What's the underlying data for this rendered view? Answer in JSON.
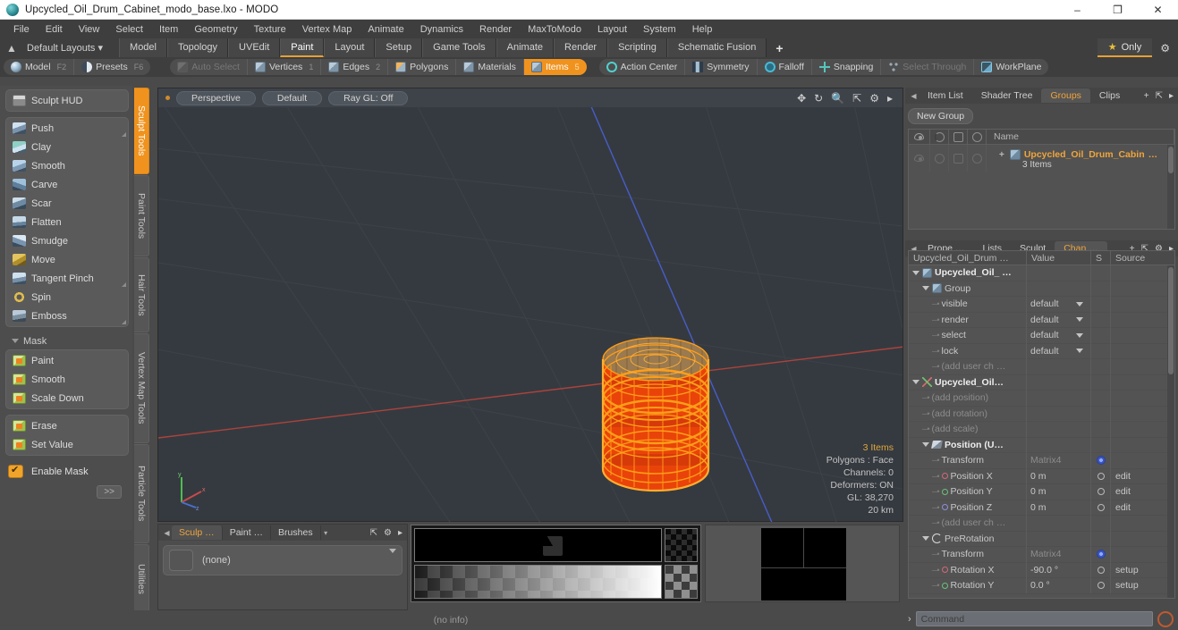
{
  "window": {
    "title": "Upcycled_Oil_Drum_Cabinet_modo_base.lxo - MODO",
    "app_icon": "modo-sphere-icon",
    "minimize": "–",
    "maximize": "❐",
    "close": "✕"
  },
  "menubar": {
    "items": [
      "File",
      "Edit",
      "View",
      "Select",
      "Item",
      "Geometry",
      "Texture",
      "Vertex Map",
      "Animate",
      "Dynamics",
      "Render",
      "MaxToModo",
      "Layout",
      "System",
      "Help"
    ]
  },
  "layoutbar": {
    "home_icon": "home-icon",
    "default_layouts": "Default Layouts",
    "tabs": [
      {
        "label": "Model",
        "active": false
      },
      {
        "label": "Topology",
        "active": false
      },
      {
        "label": "UVEdit",
        "active": false
      },
      {
        "label": "Paint",
        "active": true
      },
      {
        "label": "Layout",
        "active": false
      },
      {
        "label": "Setup",
        "active": false
      },
      {
        "label": "Game Tools",
        "active": false
      },
      {
        "label": "Animate",
        "active": false
      },
      {
        "label": "Render",
        "active": false
      },
      {
        "label": "Scripting",
        "active": false
      },
      {
        "label": "Schematic Fusion",
        "active": false
      }
    ],
    "add": "+",
    "only": "Only",
    "star_icon": "star-icon",
    "gear_icon": "gear-icon"
  },
  "modebar": {
    "left": [
      {
        "label": "Model",
        "shortcut": "F2",
        "icon": "sphere-icon",
        "state": "normal"
      },
      {
        "label": "Presets",
        "shortcut": "F6",
        "icon": "sphere-half-icon",
        "state": "normal"
      }
    ],
    "selection": [
      {
        "label": "Auto Select",
        "shortcut": "",
        "icon": "cube-dim-icon",
        "state": "dim"
      },
      {
        "label": "Vertices",
        "shortcut": "1",
        "icon": "cube-icon",
        "state": "normal"
      },
      {
        "label": "Edges",
        "shortcut": "2",
        "icon": "cube-icon",
        "state": "normal"
      },
      {
        "label": "Polygons",
        "shortcut": "",
        "icon": "cube-orange-icon",
        "state": "normal"
      },
      {
        "label": "Materials",
        "shortcut": "",
        "icon": "cube-icon",
        "state": "normal"
      },
      {
        "label": "Items",
        "shortcut": "5",
        "icon": "cube-icon",
        "state": "active"
      }
    ],
    "tools": [
      {
        "label": "Action Center",
        "icon": "crosshair-icon",
        "state": "normal"
      },
      {
        "label": "Symmetry",
        "icon": "symmetry-icon",
        "state": "normal"
      },
      {
        "label": "Falloff",
        "icon": "falloff-icon",
        "state": "normal"
      },
      {
        "label": "Snapping",
        "icon": "snapping-icon",
        "state": "normal"
      },
      {
        "label": "Select Through",
        "icon": "select-through-icon",
        "state": "dim"
      },
      {
        "label": "WorkPlane",
        "icon": "workplane-icon",
        "state": "normal"
      }
    ]
  },
  "sculpt_panel": {
    "hud_button": "Sculpt HUD",
    "hud_icon": "hud-icon",
    "tools": [
      {
        "label": "Push",
        "icon": "push-brush-icon",
        "corner": true
      },
      {
        "label": "Clay",
        "icon": "clay-brush-icon",
        "corner": false
      },
      {
        "label": "Smooth",
        "icon": "smooth-brush-icon",
        "corner": false
      },
      {
        "label": "Carve",
        "icon": "carve-brush-icon",
        "corner": false
      },
      {
        "label": "Scar",
        "icon": "scar-brush-icon",
        "corner": false
      },
      {
        "label": "Flatten",
        "icon": "flatten-brush-icon",
        "corner": false
      },
      {
        "label": "Smudge",
        "icon": "smudge-brush-icon",
        "corner": false
      },
      {
        "label": "Move",
        "icon": "move-brush-icon",
        "corner": false
      },
      {
        "label": "Tangent Pinch",
        "icon": "tangent-pinch-icon",
        "corner": true
      },
      {
        "label": "Spin",
        "icon": "spin-brush-icon",
        "corner": false
      },
      {
        "label": "Emboss",
        "icon": "emboss-brush-icon",
        "corner": true
      }
    ],
    "mask_header": "Mask",
    "mask_tools": [
      {
        "label": "Paint",
        "icon": "mask-paint-icon"
      },
      {
        "label": "Smooth",
        "icon": "mask-smooth-icon"
      },
      {
        "label": "Scale Down",
        "icon": "mask-scale-down-icon"
      }
    ],
    "mask_tools2": [
      {
        "label": "Erase",
        "icon": "mask-erase-icon"
      },
      {
        "label": "Set Value",
        "icon": "mask-set-value-icon"
      }
    ],
    "enable_mask": "Enable Mask",
    "enable_mask_checked": true,
    "more_button": ">>"
  },
  "vertical_tabs": [
    {
      "label": "Sculpt Tools",
      "active": true
    },
    {
      "label": "Paint Tools",
      "active": false
    },
    {
      "label": "Hair Tools",
      "active": false
    },
    {
      "label": "Vertex Map Tools",
      "active": false
    },
    {
      "label": "Particle Tools",
      "active": false
    },
    {
      "label": "Utilities",
      "active": false
    }
  ],
  "viewport": {
    "dot_icon": "viewport-indicator-dot",
    "buttons": [
      "Perspective",
      "Default",
      "Ray GL: Off"
    ],
    "header_icons": [
      "pan-icon",
      "rotate-icon",
      "zoom-icon",
      "fit-icon",
      "gear-icon",
      "chevron-right-icon"
    ],
    "stats": [
      "3 Items",
      "Polygons : Face",
      "Channels: 0",
      "Deformers: ON",
      "GL: 38,270",
      "20 km"
    ],
    "model": "oil-drum-wireframe",
    "axis_labels": [
      "y",
      "x",
      "z"
    ],
    "background_color": "#353a40",
    "wire_color": "#ff9e18",
    "model_body_color": "#e33a0e"
  },
  "bottom_panel": {
    "tabs": [
      {
        "label": "Sculp …",
        "active": true
      },
      {
        "label": "Paint …",
        "active": false
      },
      {
        "label": "Brushes",
        "active": false
      }
    ],
    "dropdown_icon": "chevron-down-icon",
    "tab_icons": [
      "expand-icon",
      "gear-icon",
      "chevron-right-icon"
    ],
    "brush_value": "(none)",
    "brush_swatch": "brush-preview-swatch"
  },
  "right_panel": {
    "top_tabs": [
      {
        "label": "Item List",
        "active": false
      },
      {
        "label": "Shader Tree",
        "active": false
      },
      {
        "label": "Groups",
        "active": true
      },
      {
        "label": "Clips",
        "active": false
      }
    ],
    "top_tab_icons": [
      "plus-icon",
      "expand-icon",
      "chevron-right-icon"
    ],
    "new_group_button": "New Group",
    "tree_columns": [
      "eye-icon",
      "render-icon",
      "lock-icon",
      "select-icon",
      "Name"
    ],
    "tree_rows": [
      {
        "name": "Upcycled_Oil_Drum_Cabin",
        "ellipsis": "…",
        "sub": "3 Items",
        "icon": "group-item-icon"
      }
    ],
    "mid_tabs": [
      {
        "label": "Prope …",
        "active": false
      },
      {
        "label": "Lists",
        "active": false
      },
      {
        "label": "Sculpt",
        "active": false
      },
      {
        "label": "Chan …",
        "active": true
      }
    ],
    "mid_tab_icons": [
      "plus-icon",
      "expand-icon",
      "gear-icon",
      "chevron-right-icon"
    ],
    "chan_columns": [
      "Upcycled_Oil_Drum …",
      "Value",
      "S",
      "Source"
    ],
    "chan_rows": [
      {
        "indent": 0,
        "twisty": "down",
        "icon": "item-icon",
        "label": "Upcycled_Oil_ …",
        "value": "",
        "bold": true,
        "dim": false,
        "s": "",
        "source": ""
      },
      {
        "indent": 1,
        "twisty": "down",
        "icon": "item-icon",
        "label": "Group",
        "value": "",
        "bold": false,
        "dim": false,
        "s": "",
        "source": ""
      },
      {
        "indent": 2,
        "twisty": "leaf",
        "icon": "",
        "label": "visible",
        "value": "default",
        "dropdown": true,
        "bold": false,
        "dim": false,
        "s": "",
        "source": ""
      },
      {
        "indent": 2,
        "twisty": "leaf",
        "icon": "",
        "label": "render",
        "value": "default",
        "dropdown": true,
        "bold": false,
        "dim": false,
        "s": "",
        "source": ""
      },
      {
        "indent": 2,
        "twisty": "leaf",
        "icon": "",
        "label": "select",
        "value": "default",
        "dropdown": true,
        "bold": false,
        "dim": false,
        "s": "",
        "source": ""
      },
      {
        "indent": 2,
        "twisty": "leaf",
        "icon": "",
        "label": "lock",
        "value": "default",
        "dropdown": true,
        "bold": false,
        "dim": false,
        "s": "",
        "source": ""
      },
      {
        "indent": 2,
        "twisty": "leaf",
        "icon": "",
        "label": "(add user ch …",
        "value": "",
        "bold": false,
        "dim": true,
        "s": "",
        "source": ""
      },
      {
        "indent": 0,
        "twisty": "down",
        "icon": "axis-icon",
        "label": "Upcycled_Oil…",
        "value": "",
        "bold": true,
        "dim": false,
        "s": "",
        "source": ""
      },
      {
        "indent": 1,
        "twisty": "leaf",
        "icon": "",
        "label": "(add position)",
        "value": "",
        "bold": false,
        "dim": true,
        "s": "",
        "source": ""
      },
      {
        "indent": 1,
        "twisty": "leaf",
        "icon": "",
        "label": "(add rotation)",
        "value": "",
        "bold": false,
        "dim": true,
        "s": "",
        "source": ""
      },
      {
        "indent": 1,
        "twisty": "leaf",
        "icon": "",
        "label": "(add scale)",
        "value": "",
        "bold": false,
        "dim": true,
        "s": "",
        "source": ""
      },
      {
        "indent": 1,
        "twisty": "down",
        "icon": "pen-icon",
        "label": "Position (U…",
        "value": "",
        "bold": true,
        "dim": false,
        "s": "",
        "source": ""
      },
      {
        "indent": 2,
        "twisty": "leaf",
        "icon": "",
        "label": "Transform",
        "value": "Matrix4",
        "valuedim": true,
        "bold": false,
        "dim": false,
        "s": "gear",
        "source": ""
      },
      {
        "indent": 2,
        "twisty": "leaf",
        "icon": "dot-red",
        "label": "Position X",
        "value": "0 m",
        "bold": false,
        "dim": false,
        "s": "circle",
        "source": "edit"
      },
      {
        "indent": 2,
        "twisty": "leaf",
        "icon": "dot-green",
        "label": "Position Y",
        "value": "0 m",
        "bold": false,
        "dim": false,
        "s": "circle",
        "source": "edit"
      },
      {
        "indent": 2,
        "twisty": "leaf",
        "icon": "dot-blue",
        "label": "Position Z",
        "value": "0 m",
        "bold": false,
        "dim": false,
        "s": "circle",
        "source": "edit"
      },
      {
        "indent": 2,
        "twisty": "leaf",
        "icon": "",
        "label": "(add user ch …",
        "value": "",
        "bold": false,
        "dim": true,
        "s": "",
        "source": ""
      },
      {
        "indent": 1,
        "twisty": "down",
        "icon": "rot-icon",
        "label": "PreRotation",
        "value": "",
        "bold": false,
        "dim": false,
        "s": "",
        "source": ""
      },
      {
        "indent": 2,
        "twisty": "leaf",
        "icon": "",
        "label": "Transform",
        "value": "Matrix4",
        "valuedim": true,
        "bold": false,
        "dim": false,
        "s": "gear",
        "source": ""
      },
      {
        "indent": 2,
        "twisty": "leaf",
        "icon": "dot-red",
        "label": "Rotation X",
        "value": "-90.0 °",
        "bold": false,
        "dim": false,
        "s": "circle",
        "source": "setup"
      },
      {
        "indent": 2,
        "twisty": "leaf",
        "icon": "dot-green",
        "label": "Rotation Y",
        "value": "0.0 °",
        "bold": false,
        "dim": false,
        "s": "circle",
        "source": "setup"
      }
    ]
  },
  "statusbar": {
    "info": "(no info)",
    "command_caret": "›",
    "command_placeholder": "Command",
    "record_icon": "record-icon"
  }
}
